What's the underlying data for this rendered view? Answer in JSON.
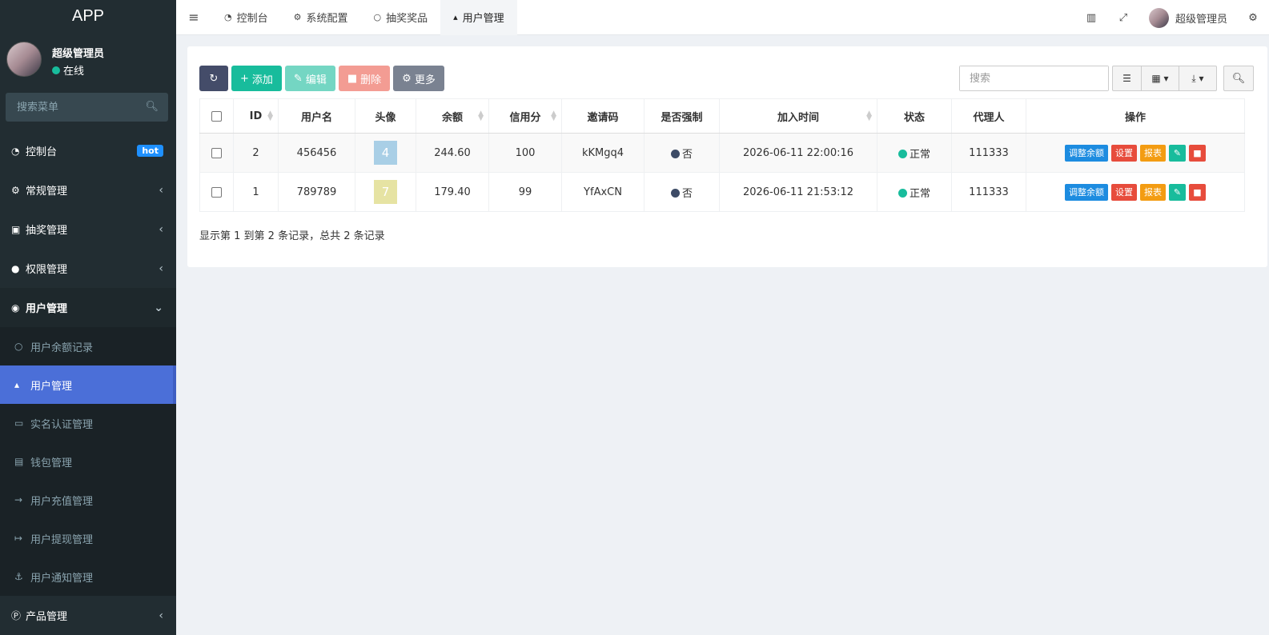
{
  "app": {
    "title": "APP"
  },
  "user": {
    "name": "超级管理员",
    "status": "在线"
  },
  "search_menu": {
    "placeholder": "搜索菜单"
  },
  "menu": {
    "dashboard": "控制台",
    "dashboard_badge": "hot",
    "general": "常规管理",
    "lottery": "抽奖管理",
    "permission": "权限管理",
    "users": "用户管理",
    "sub": {
      "balance_log": "用户余额记录",
      "user_mgmt": "用户管理",
      "realname": "实名认证管理",
      "wallet": "钱包管理",
      "recharge": "用户充值管理",
      "withdraw": "用户提现管理",
      "notify": "用户通知管理"
    },
    "product": "产品管理"
  },
  "tabs": [
    {
      "label": "控制台",
      "icon": "dashboard-icon"
    },
    {
      "label": "系统配置",
      "icon": "gear-icon"
    },
    {
      "label": "抽奖奖品",
      "icon": "circle-icon"
    },
    {
      "label": "用户管理",
      "icon": "user-icon"
    }
  ],
  "header_user": "超级管理员",
  "toolbar": {
    "add": "添加",
    "edit": "编辑",
    "delete": "删除",
    "more": "更多",
    "search_placeholder": "搜索"
  },
  "table": {
    "headers": [
      "ID",
      "用户名",
      "头像",
      "余额",
      "信用分",
      "邀请码",
      "是否强制",
      "加入时间",
      "状态",
      "代理人",
      "操作"
    ],
    "rows": [
      {
        "id": "2",
        "username": "456456",
        "avatar": "4",
        "avatar_color": "#a9cfe6",
        "balance": "244.60",
        "credit": "100",
        "invite": "kKMgq4",
        "forced": "否",
        "joined": "2026-06-11 22:00:16",
        "status": "正常",
        "agent": "111333"
      },
      {
        "id": "1",
        "username": "789789",
        "avatar": "7",
        "avatar_color": "#e6e3a3",
        "balance": "179.40",
        "credit": "99",
        "invite": "YfAxCN",
        "forced": "否",
        "joined": "2026-06-11 21:53:12",
        "status": "正常",
        "agent": "111333"
      }
    ],
    "ops": {
      "adjust": "调整余额",
      "settings": "设置",
      "report": "报表"
    }
  },
  "footer": "显示第 1 到第 2 条记录，总共 2 条记录",
  "colors": {
    "sidebar": "#222d32",
    "accent": "#18bc9c",
    "active": "#4b6fd8"
  }
}
